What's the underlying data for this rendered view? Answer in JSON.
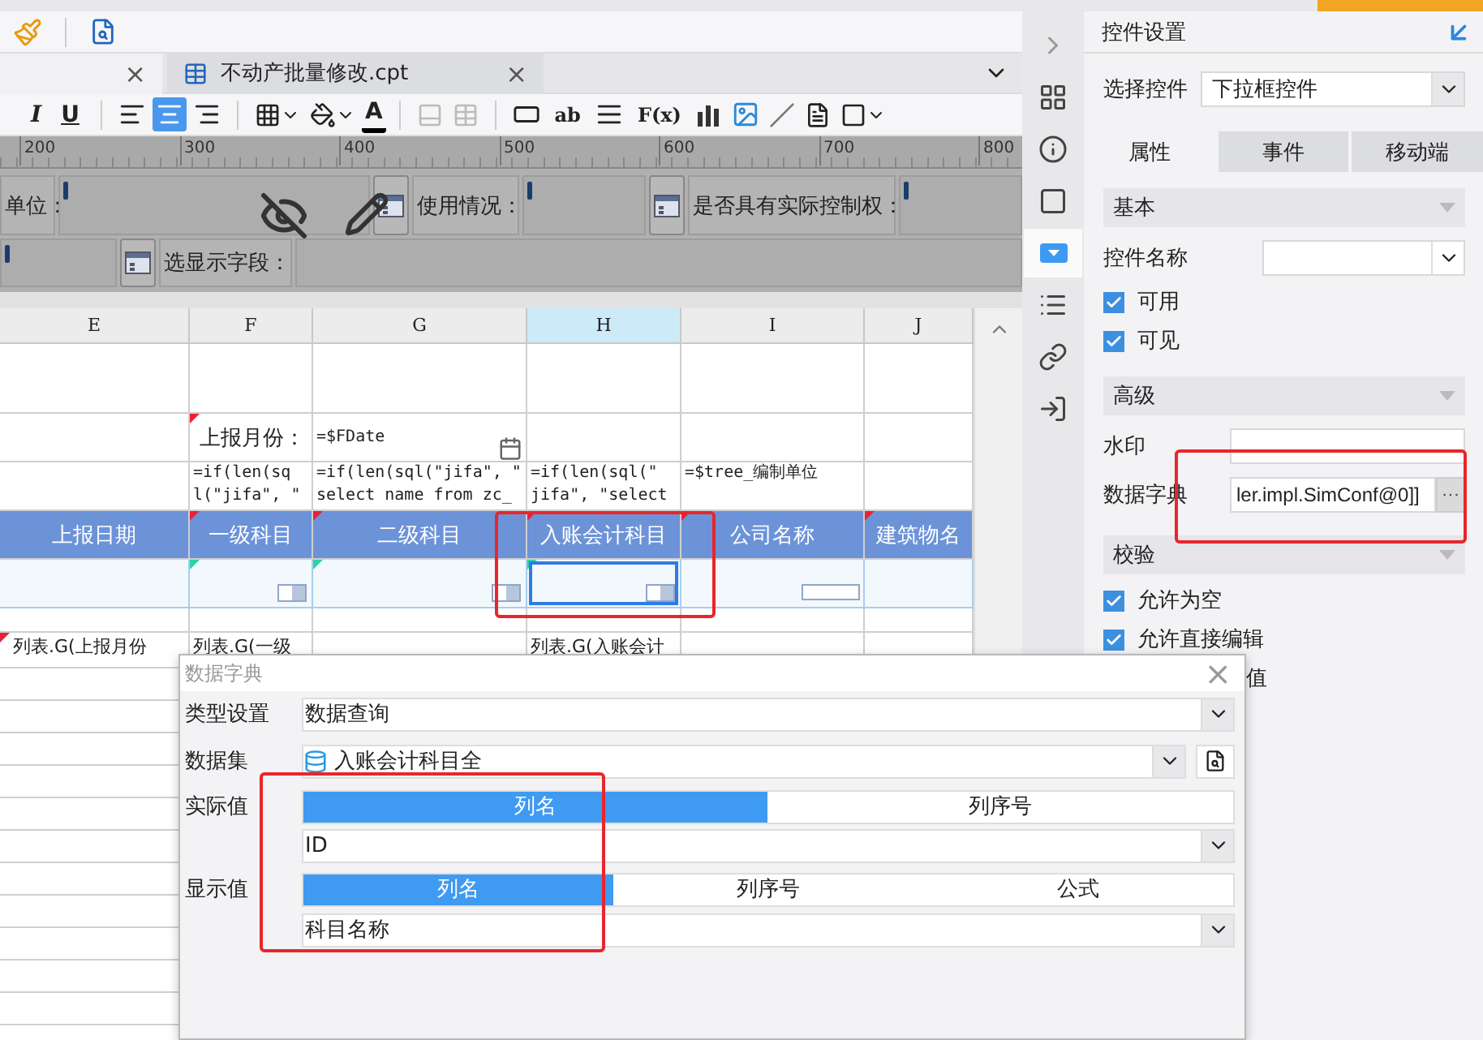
{
  "tabs": [
    {
      "close": "×",
      "selected": true
    },
    {
      "label": "不动产批量修改.cpt",
      "close": "×",
      "selected": false
    }
  ],
  "format_toolbar": [
    {
      "kind": "italic",
      "label": "I"
    },
    {
      "kind": "underline",
      "label": "U"
    },
    {
      "kind": "sep"
    },
    {
      "kind": "align_left",
      "selected": false
    },
    {
      "kind": "align_center",
      "selected": true
    },
    {
      "kind": "align_right",
      "selected": false
    },
    {
      "kind": "sep"
    },
    {
      "kind": "borders"
    },
    {
      "kind": "fill"
    },
    {
      "kind": "font_color",
      "label": "A"
    },
    {
      "kind": "sep"
    },
    {
      "kind": "merge"
    },
    {
      "kind": "unmerge"
    },
    {
      "kind": "sep"
    },
    {
      "kind": "textbox"
    },
    {
      "kind": "text",
      "label": "ab"
    },
    {
      "kind": "paragraph"
    },
    {
      "kind": "text",
      "label": "F(x)"
    },
    {
      "kind": "chart"
    },
    {
      "kind": "image"
    },
    {
      "kind": "slash"
    },
    {
      "kind": "richtext"
    },
    {
      "kind": "frame"
    }
  ],
  "ruler": [
    "200",
    "300",
    "400",
    "500",
    "600",
    "700",
    "800"
  ],
  "parameters": [
    [
      {
        "kind": "label",
        "text": "单位："
      },
      {
        "kind": "field",
        "caret": true
      },
      {
        "kind": "widget"
      },
      {
        "kind": "label",
        "text": "使用情况："
      },
      {
        "kind": "field",
        "caret": true
      },
      {
        "kind": "widget"
      },
      {
        "kind": "label",
        "text": "是否具有实际控制权："
      },
      {
        "kind": "field",
        "caret": true
      }
    ],
    [
      {
        "kind": "field",
        "caret": true
      },
      {
        "kind": "widget"
      },
      {
        "kind": "label",
        "text": "选显示字段："
      },
      {
        "kind": "field",
        "caret": false
      }
    ]
  ],
  "sheet": {
    "columns": [
      {
        "label": "E",
        "selected": false
      },
      {
        "label": "F",
        "selected": false
      },
      {
        "label": "G",
        "selected": false
      },
      {
        "label": "H",
        "selected": true
      },
      {
        "label": "I",
        "selected": false
      },
      {
        "label": "J",
        "selected": false
      }
    ],
    "rows": [
      {
        "kind": "blank",
        "cells": [
          {
            "kind": "empty"
          },
          {
            "kind": "empty"
          },
          {
            "kind": "empty"
          },
          {
            "kind": "empty"
          },
          {
            "kind": "empty"
          },
          {
            "kind": "empty"
          }
        ]
      },
      {
        "kind": "params",
        "cells": [
          {
            "kind": "empty"
          },
          {
            "kind": "label",
            "text": "上报月份：",
            "marker": true
          },
          {
            "kind": "date",
            "text": "=$FDate"
          },
          {
            "kind": "empty"
          },
          {
            "kind": "empty"
          },
          {
            "kind": "empty"
          }
        ]
      },
      {
        "kind": "formula",
        "cells": [
          {
            "kind": "empty"
          },
          {
            "kind": "formula",
            "text": "=if(len(sq\nl(\"jifa\", \""
          },
          {
            "kind": "formula",
            "text": "=if(len(sql(\"jifa\", \"\nselect name from zc_"
          },
          {
            "kind": "formula",
            "text": "=if(len(sql(\"\njifa\", \"select"
          },
          {
            "kind": "formula",
            "text": "=$tree_编制单位"
          },
          {
            "kind": "empty"
          }
        ]
      },
      {
        "kind": "header",
        "cells": [
          {
            "kind": "header",
            "text": "上报日期"
          },
          {
            "kind": "header",
            "text": "一级科目",
            "marker": true
          },
          {
            "kind": "header",
            "text": "二级科目",
            "marker": true
          },
          {
            "kind": "header",
            "text": "入账会计科目",
            "marker": true
          },
          {
            "kind": "header",
            "text": "公司名称",
            "marker": true
          },
          {
            "kind": "header",
            "text": "建筑物名",
            "marker": true
          }
        ]
      },
      {
        "kind": "widgets",
        "cells": [
          {
            "kind": "empty",
            "selected": false
          },
          {
            "kind": "dropdown",
            "marker": true,
            "selected": false
          },
          {
            "kind": "dropdown",
            "marker": true,
            "selected": false
          },
          {
            "kind": "dropdown",
            "marker": true,
            "selected": true
          },
          {
            "kind": "textbox",
            "selected": false
          },
          {
            "kind": "empty",
            "selected": false
          }
        ]
      },
      {
        "kind": "blank",
        "cells": [
          {
            "kind": "empty"
          },
          {
            "kind": "empty"
          },
          {
            "kind": "empty"
          },
          {
            "kind": "empty"
          },
          {
            "kind": "empty"
          },
          {
            "kind": "empty"
          }
        ]
      },
      {
        "kind": "list",
        "cells": [
          {
            "kind": "list",
            "text": "列表.G(上报月份",
            "marker": true
          },
          {
            "kind": "list",
            "text": "列表.G(一级"
          },
          {
            "kind": "empty"
          },
          {
            "kind": "list",
            "text": "列表.G(入账会计"
          },
          {
            "kind": "empty"
          },
          {
            "kind": "empty"
          }
        ]
      }
    ]
  },
  "icon_strip": [
    {
      "kind": "collapse",
      "selected": false
    },
    {
      "kind": "layout",
      "selected": false
    },
    {
      "kind": "info",
      "selected": false
    },
    {
      "kind": "frame",
      "selected": false
    },
    {
      "kind": "widget",
      "selected": true
    },
    {
      "kind": "list",
      "selected": false
    },
    {
      "kind": "link",
      "selected": false
    },
    {
      "kind": "import",
      "selected": false
    }
  ],
  "panel": {
    "title": "控件设置",
    "select_label": "选择控件",
    "select_value": "下拉框控件",
    "tabs": [
      {
        "label": "属性",
        "selected": true
      },
      {
        "label": "事件",
        "selected": false
      },
      {
        "label": "移动端",
        "selected": false
      }
    ],
    "sections": [
      {
        "title": "基本",
        "items": [
          {
            "kind": "select",
            "label": "控件名称"
          },
          {
            "kind": "checkbox",
            "label": "可用",
            "checked": true
          },
          {
            "kind": "checkbox",
            "label": "可见",
            "checked": true
          }
        ]
      },
      {
        "title": "高级",
        "items": [
          {
            "kind": "input",
            "label": "水印"
          },
          {
            "kind": "button_field",
            "label": "数据字典",
            "value": "ler.impl.SimConf@0]]",
            "button": "···"
          }
        ]
      },
      {
        "title": "校验",
        "items": [
          {
            "kind": "checkbox",
            "label": "允许为空",
            "checked": true
          },
          {
            "kind": "checkbox",
            "label": "允许直接编辑",
            "checked": true
          },
          {
            "kind": "partial",
            "label": "值"
          }
        ]
      }
    ]
  },
  "dialog": {
    "title": "数据字典",
    "close": "×",
    "rows": [
      {
        "kind": "select",
        "label": "类型设置",
        "value": "数据查询"
      },
      {
        "kind": "dataset",
        "label": "数据集",
        "value": "入账会计科目全"
      },
      {
        "kind": "segments",
        "label": "实际值",
        "options": [
          {
            "label": "列名",
            "selected": true
          },
          {
            "label": "列序号",
            "selected": false
          }
        ]
      },
      {
        "kind": "select",
        "value": "ID"
      },
      {
        "kind": "segments",
        "label": "显示值",
        "options": [
          {
            "label": "列名",
            "selected": true
          },
          {
            "label": "列序号",
            "selected": false
          },
          {
            "label": "公式",
            "selected": false
          }
        ]
      },
      {
        "kind": "select",
        "value": "科目名称"
      }
    ]
  },
  "annotations": [
    {
      "kind": "cell"
    },
    {
      "kind": "field"
    },
    {
      "kind": "dialog"
    }
  ]
}
